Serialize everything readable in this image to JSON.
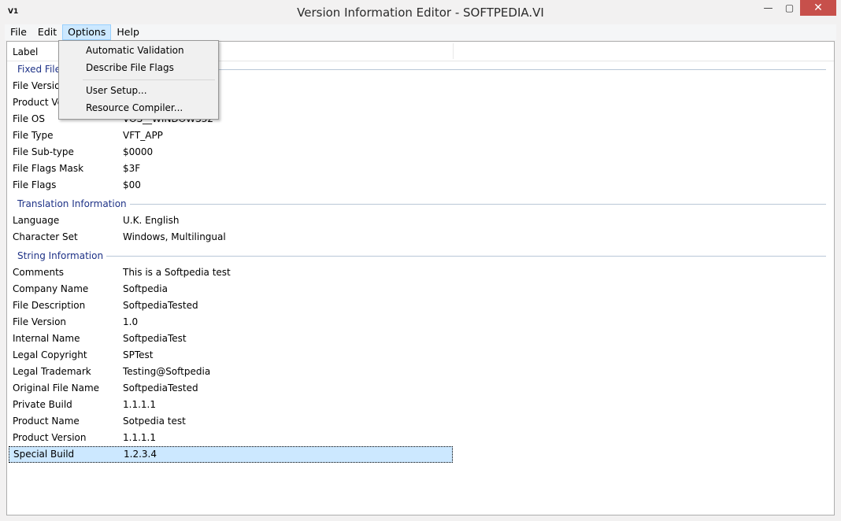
{
  "window": {
    "title": "Version Information Editor - SOFTPEDIA.VI",
    "icon_label": "V1",
    "controls": {
      "minimize": "—",
      "maximize": "▢",
      "close": "✕"
    }
  },
  "menubar": {
    "items": [
      "File",
      "Edit",
      "Options",
      "Help"
    ],
    "active": "Options"
  },
  "options_menu": {
    "items": [
      "Automatic Validation",
      "Describe File Flags",
      "User Setup...",
      "Resource Compiler..."
    ]
  },
  "table": {
    "header_label": "Label",
    "groups": {
      "fixed": "Fixed File",
      "translation": "Translation Information",
      "string": "String Information"
    },
    "fixed_rows": [
      {
        "key": "File Versio",
        "value": ""
      },
      {
        "key": "Product Ve",
        "value": ""
      },
      {
        "key": "File OS",
        "value": "VOS__WINDOWS32"
      },
      {
        "key": "File Type",
        "value": "VFT_APP"
      },
      {
        "key": "File Sub-type",
        "value": "$0000"
      },
      {
        "key": "File Flags Mask",
        "value": "$3F"
      },
      {
        "key": "File Flags",
        "value": "$00"
      }
    ],
    "translation_rows": [
      {
        "key": "Language",
        "value": "U.K. English"
      },
      {
        "key": "Character Set",
        "value": "Windows, Multilingual"
      }
    ],
    "string_rows": [
      {
        "key": "Comments",
        "value": "This is a Softpedia test"
      },
      {
        "key": "Company Name",
        "value": "Softpedia"
      },
      {
        "key": "File Description",
        "value": "SoftpediaTested"
      },
      {
        "key": "File Version",
        "value": "1.0"
      },
      {
        "key": "Internal Name",
        "value": "SoftpediaTest"
      },
      {
        "key": "Legal Copyright",
        "value": "SPTest"
      },
      {
        "key": "Legal Trademark",
        "value": "Testing@Softpedia"
      },
      {
        "key": "Original File Name",
        "value": "SoftpediaTested"
      },
      {
        "key": "Private Build",
        "value": "1.1.1.1"
      },
      {
        "key": "Product Name",
        "value": "Sotpedia test"
      },
      {
        "key": "Product Version",
        "value": "1.1.1.1"
      },
      {
        "key": "Special Build",
        "value": "1.2.3.4"
      }
    ],
    "selected_row": "Special Build"
  },
  "colors": {
    "group_label": "#1e3287",
    "selection": "#cce8ff",
    "close_button": "#c7504b"
  }
}
